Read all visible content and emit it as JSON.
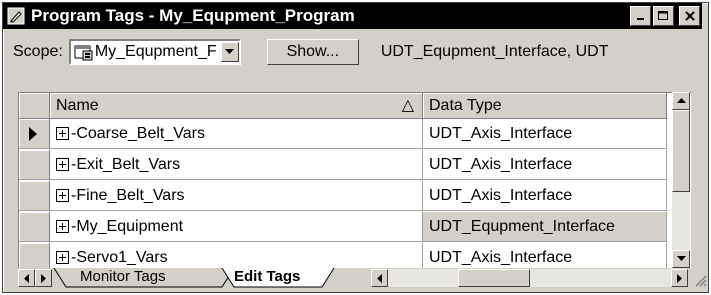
{
  "window": {
    "title": "Program Tags - My_Equpment_Program",
    "icon": "pencil-icon"
  },
  "toolbar": {
    "scope_label": "Scope:",
    "scope_value": "My_Equpment_F",
    "show_label": "Show...",
    "filter_text": "UDT_Equpment_Interface, UDT"
  },
  "grid": {
    "columns": [
      "Name",
      "Data Type"
    ],
    "sort_indicator": "△",
    "rows": [
      {
        "name": "-Coarse_Belt_Vars",
        "data_type": "UDT_Axis_Interface"
      },
      {
        "name": "-Exit_Belt_Vars",
        "data_type": "UDT_Axis_Interface"
      },
      {
        "name": "-Fine_Belt_Vars",
        "data_type": "UDT_Axis_Interface"
      },
      {
        "name": "-My_Equipment",
        "data_type": "UDT_Equpment_Interface"
      },
      {
        "name": "-Servo1_Vars",
        "data_type": "UDT_Axis_Interface"
      }
    ]
  },
  "tabs": [
    {
      "label": "Monitor Tags"
    },
    {
      "label": "Edit Tags"
    }
  ],
  "colors": {
    "title_bg": "#000000",
    "face": "#d4d0c8"
  }
}
